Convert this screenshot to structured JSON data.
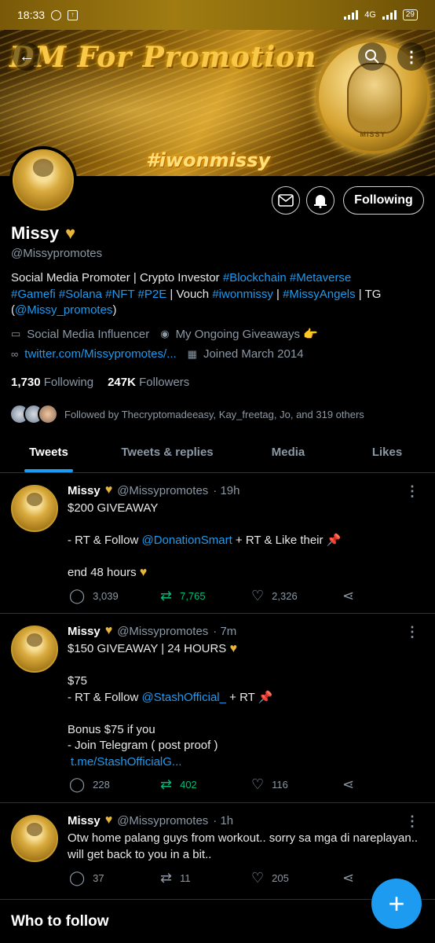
{
  "status_bar": {
    "time": "18:33",
    "network": "4G",
    "battery": "29"
  },
  "banner": {
    "title": "DM For Promotion",
    "hashtag": "#iwonmissy",
    "coin_label": "MISSY"
  },
  "profile": {
    "name": "Missy",
    "handle": "@Missypromotes",
    "follow_label": "Following",
    "bio_plain_1": "Social Media Promoter | Crypto Investor ",
    "bio_tag_blockchain": "#Blockchain",
    "bio_tag_metaverse": "#Metaverse",
    "bio_tag_gamefi": "#Gamefi",
    "bio_tag_solana": "#Solana",
    "bio_tag_nft": "#NFT",
    "bio_tag_p2e": "#P2E",
    "bio_plain_2": " | Vouch ",
    "bio_tag_iwonmissy": "#iwonmissy",
    "bio_plain_3": " | ",
    "bio_tag_missyangels": "#MissyAngels",
    "bio_plain_4": " | TG",
    "bio_open_paren": "(",
    "bio_mention": "@Missy_promotes",
    "bio_close_paren": ")",
    "category": "Social Media Influencer",
    "location": "My Ongoing Giveaways 👉",
    "website": "twitter.com/Missypromotes/...",
    "joined": "Joined March 2014",
    "following_count": "1,730",
    "following_label": "Following",
    "followers_count": "247K",
    "followers_label": "Followers",
    "followed_by": "Followed by Thecryptomadeeasy, Kay_freetag, Jo, and 319 others"
  },
  "tabs": [
    {
      "label": "Tweets"
    },
    {
      "label": "Tweets & replies"
    },
    {
      "label": "Media"
    },
    {
      "label": "Likes"
    }
  ],
  "tweets": [
    {
      "name": "Missy",
      "handle": "@Missypromotes",
      "time": "· 19h",
      "line1": "$200 GIVEAWAY",
      "line2_pre": "- RT & Follow ",
      "line2_link": "@DonationSmart",
      "line2_post": " + RT & Like their 📌",
      "line3": "end 48 hours",
      "replies": "3,039",
      "retweets": "7,765",
      "likes": "2,326"
    },
    {
      "name": "Missy",
      "handle": "@Missypromotes",
      "time": "· 7m",
      "line1": "$150 GIVEAWAY | 24 HOURS",
      "line2": "$75",
      "line3_pre": "- RT & Follow ",
      "line3_link": "@StashOfficial_",
      "line3_post": "  + RT 📌",
      "line4": "Bonus $75 if you",
      "line5": "- Join Telegram ( post proof )",
      "line6": "t.me/StashOfficialG...",
      "replies": "228",
      "retweets": "402",
      "likes": "116"
    },
    {
      "name": "Missy",
      "handle": "@Missypromotes",
      "time": "· 1h",
      "text": "Otw home palang guys from workout.. sorry sa mga di nareplayan.. will get back to you in a bit..",
      "replies": "37",
      "retweets": "11",
      "likes": "205"
    }
  ],
  "who_to_follow": "Who to follow",
  "icons": [
    "back-arrow-icon",
    "search-icon",
    "more-vertical-icon",
    "mail-icon",
    "bell-icon",
    "briefcase-icon",
    "location-icon",
    "link-icon",
    "calendar-icon",
    "reply-icon",
    "retweet-icon",
    "like-icon",
    "share-icon",
    "compose-icon"
  ],
  "colors": {
    "accent": "#1d9bf0",
    "retweet": "#00ba7c",
    "gold": "#e6b53a"
  }
}
